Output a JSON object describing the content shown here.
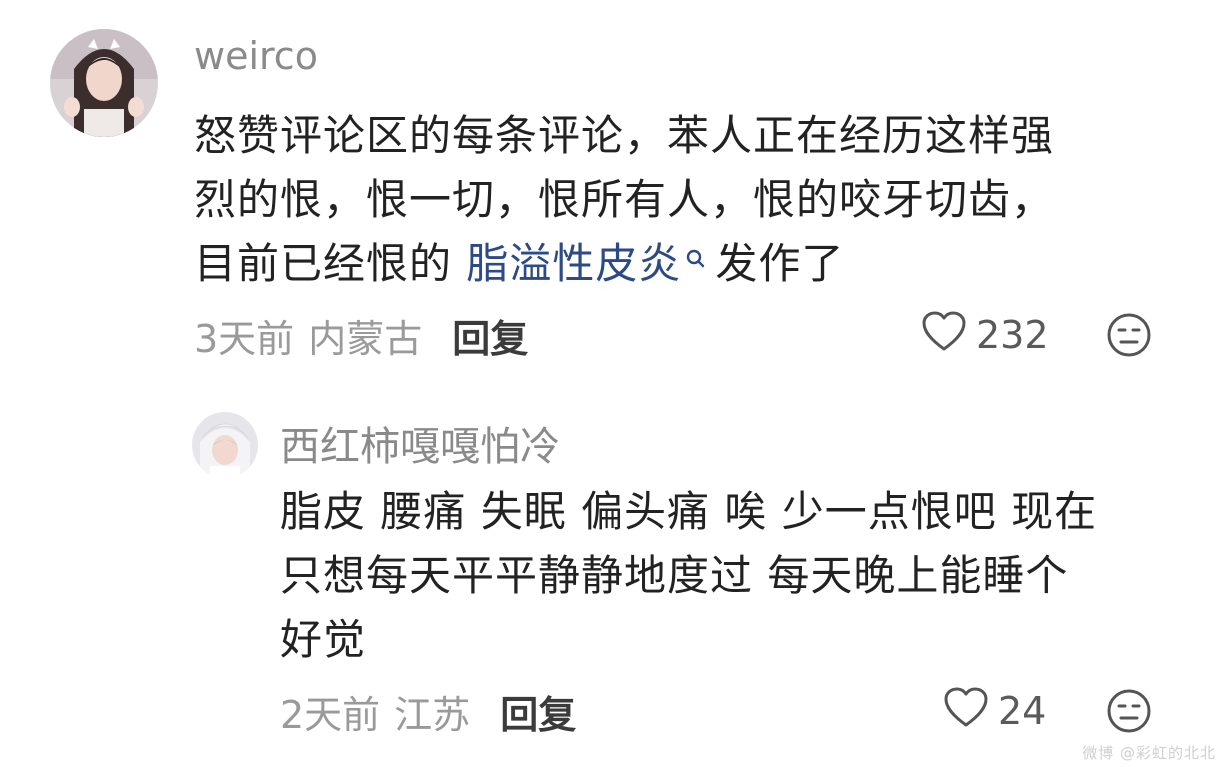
{
  "comment": {
    "username": "weirco",
    "text_lines": [
      "怒赞评论区的每条评论，苯人正在经历这样强",
      "烈的恨，恨一切，恨所有人，恨的咬牙切齿，"
    ],
    "line3_before": "目前已经恨的 ",
    "search_link": "脂溢性皮炎",
    "line3_after": "发作了",
    "time": "3天前",
    "location": "内蒙古",
    "reply_label": "回复",
    "likes": "232",
    "like_icon": "heart-outline-icon",
    "emoji_icon": "neutral-face-icon"
  },
  "reply": {
    "username": "西红柿嘎嘎怕冷",
    "text_lines": [
      "脂皮 腰痛 失眠 偏头痛 唉 少一点恨吧 现在",
      "只想每天平平静静地度过 每天晚上能睡个",
      "好觉"
    ],
    "time": "2天前",
    "location": "江苏",
    "reply_label": "回复",
    "likes": "24",
    "like_icon": "heart-outline-icon",
    "emoji_icon": "neutral-face-icon"
  },
  "watermark": "微博 @彩虹的北北",
  "colors": {
    "text": "#222222",
    "muted": "#8a8a8a",
    "link": "#2b4a86"
  }
}
